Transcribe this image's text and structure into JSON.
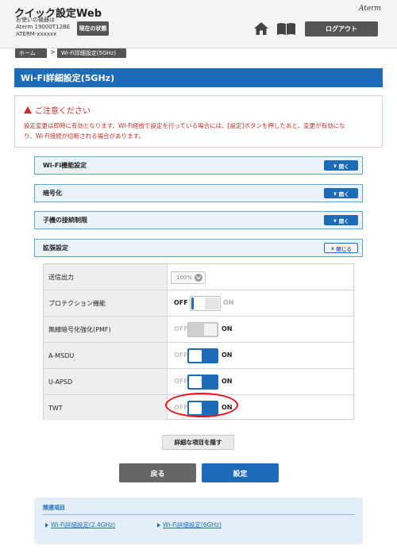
{
  "header": {
    "app_title": "クイック設定Web",
    "device_line1": "お使いの機器は",
    "device_line2": "Aterm 19000T12BE",
    "device_line3": "ATERM-xxxxxx",
    "status_button": "現在の状態",
    "brand": "Aterm",
    "logout_button": "ログアウト"
  },
  "breadcrumb": {
    "home": "ホーム",
    "separator": ">",
    "current": "Wi-Fi詳細設定(5GHz)"
  },
  "page_title": "Wi-Fi詳細設定(5GHz)",
  "notice": {
    "title": "ご注意ください",
    "line1": "設定変更は即時に有効となります。Wi-Fi経由で設定を行っている場合には、[設定]ボタンを押したあと、変更が有効にな",
    "line2": "り、Wi-Fi接続が切断される場合があります。"
  },
  "sections": [
    {
      "label": "Wi-Fi機能設定",
      "button": "開く"
    },
    {
      "label": "暗号化",
      "button": "開く"
    },
    {
      "label": "子機の接続制限",
      "button": "開く"
    },
    {
      "label": "拡張設定",
      "button": "閉じる"
    }
  ],
  "settings": [
    {
      "label": "送信出力",
      "value": "100%"
    },
    {
      "label": "プロテクション機能",
      "off": "OFF",
      "on": "ON",
      "state": "off",
      "enabled": true
    },
    {
      "label": "無線暗号化強化(PMF)",
      "off": "OFF",
      "on": "ON",
      "state": "off",
      "enabled": false
    },
    {
      "label": "A-MSDU",
      "off": "OFF",
      "on": "ON",
      "state": "on",
      "enabled": true
    },
    {
      "label": "U-APSD",
      "off": "OFF",
      "on": "ON",
      "state": "on",
      "enabled": true
    },
    {
      "label": "TWT",
      "off": "OFF",
      "on": "ON",
      "state": "on",
      "enabled": true
    }
  ],
  "buttons": {
    "hide_details": "詳細な項目を隠す",
    "back": "戻る",
    "apply": "設定"
  },
  "related": {
    "title": "関連項目",
    "links": [
      "Wi-Fi詳細設定(2.4GHz)",
      "Wi-Fi詳細設定(6GHz)"
    ]
  },
  "colors": {
    "accent": "#1e6bb8",
    "alert": "#c03028",
    "highlight": "#e8141c"
  }
}
